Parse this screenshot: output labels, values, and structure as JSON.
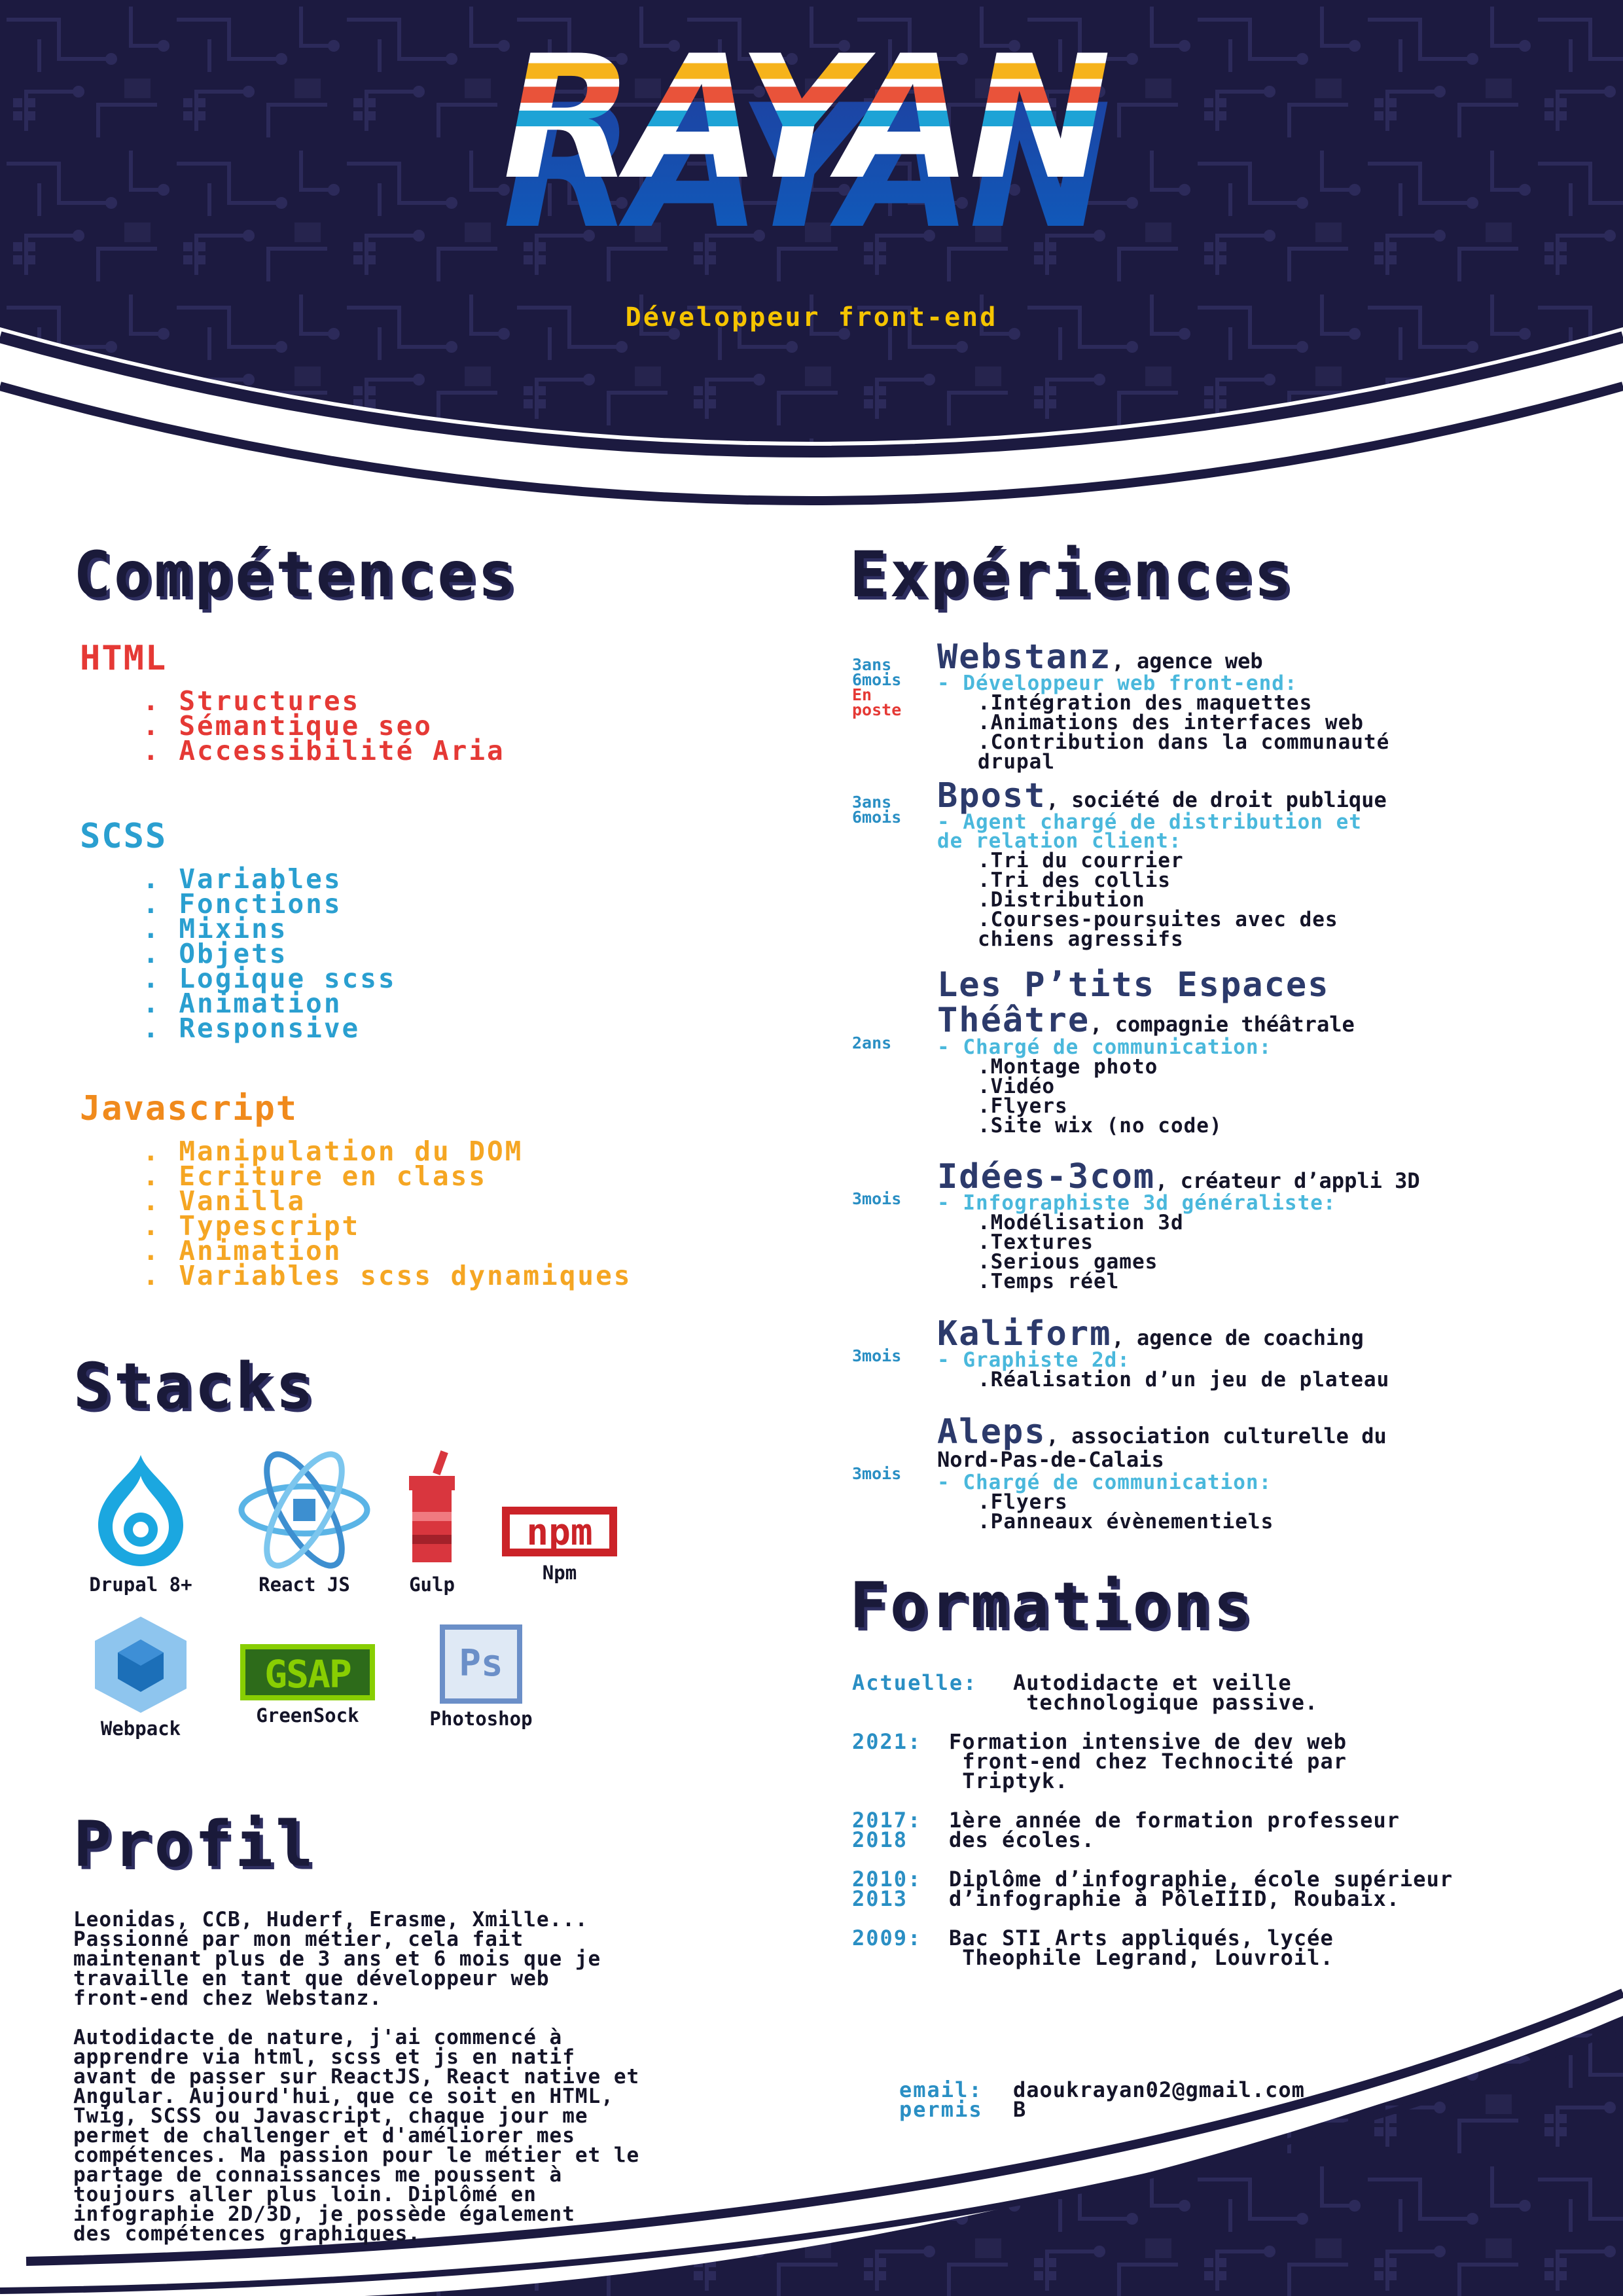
{
  "header": {
    "name": "RAYAN",
    "subtitle": "Développeur front-end"
  },
  "competences": {
    "title": "Compétences",
    "groups": [
      {
        "title": "HTML",
        "color": "#e53935",
        "items": [
          ". Structures",
          ". Sémantique seo",
          ". Accessibilité Aria"
        ]
      },
      {
        "title": "SCSS",
        "color": "#2a9fd0",
        "items": [
          ". Variables",
          ". Fonctions",
          ". Mixins",
          ". Objets",
          ". Logique scss",
          ". Animation",
          ". Responsive"
        ]
      },
      {
        "title": "Javascript",
        "color": "#f08a1c",
        "items": [
          ". Manipulation du DOM",
          ". Ecriture en class",
          ". Vanilla",
          ". Typescript",
          ". Animation",
          ". Variables scss dynamiques"
        ]
      }
    ]
  },
  "stacks": {
    "title": "Stacks",
    "items": [
      {
        "label": "Drupal 8+",
        "icon": "drupal-icon"
      },
      {
        "label": "React JS",
        "icon": "react-icon"
      },
      {
        "label": "Gulp",
        "icon": "gulp-icon"
      },
      {
        "label": "Npm",
        "icon": "npm-icon"
      },
      {
        "label": "Webpack",
        "icon": "webpack-icon"
      },
      {
        "label": "GreenSock",
        "icon": "gsap-icon"
      },
      {
        "label": "Photoshop",
        "icon": "photoshop-icon"
      }
    ],
    "logo_texts": {
      "npm": "npm",
      "gsap": "GSAP",
      "ps": "Ps"
    }
  },
  "profil": {
    "title": "Profil",
    "paragraphs": [
      "Leonidas, CCB, Huderf, Erasme, Xmille...\nPassionné par mon métier, cela fait\nmaintenant plus de 3 ans et 6 mois que je\ntravaille en tant que développeur web\nfront-end chez Webstanz.",
      "Autodidacte de nature, j'ai commencé à\napprendre via html, scss et js en natif\navant de passer sur ReactJS, React native et\nAngular. Aujourd'hui, que ce soit en HTML,\nTwig, SCSS ou Javascript, chaque jour me\npermet de challenger et d'améliorer mes\ncompétences. Ma passion pour le métier et le\npartage de connaissances me poussent à\ntoujours aller plus loin. Diplômé en\ninfographie 2D/3D, je possède également\ndes compétences graphiques."
    ]
  },
  "experiences": {
    "title": "Expériences",
    "items": [
      {
        "duration": "3ans\n6mois",
        "current": "En\nposte",
        "company": "Webstanz",
        "desc": ", agence web",
        "role": "- Développeur web front-end:",
        "tasks": [
          ".Intégration des maquettes",
          ".Animations des interfaces web",
          ".Contribution dans la communauté\ndrupal"
        ]
      },
      {
        "duration": "3ans\n6mois",
        "current": "",
        "company": "Bpost",
        "desc": ", société de droit publique",
        "role": "- Agent chargé de distribution et\nde relation client:",
        "tasks": [
          ".Tri du courrier",
          ".Tri des collis",
          ".Distribution",
          ".Courses-poursuites avec des\nchiens agressifs"
        ]
      },
      {
        "duration": "2ans",
        "current": "",
        "company": "Les P’tits Espaces\nThéâtre",
        "desc": ", compagnie théâtrale",
        "role": "- Chargé de communication:",
        "tasks": [
          ".Montage photo",
          ".Vidéo",
          ".Flyers",
          ".Site wix (no code)"
        ]
      },
      {
        "duration": "3mois",
        "current": "",
        "company": "Idées-3com",
        "desc": ", créateur d’appli 3D",
        "role": "- Infographiste 3d généraliste:",
        "tasks": [
          ".Modélisation 3d",
          ".Textures",
          ".Serious games",
          ".Temps réel"
        ]
      },
      {
        "duration": "3mois",
        "current": "",
        "company": "Kaliform",
        "desc": ", agence de coaching",
        "role": "- Graphiste 2d:",
        "tasks": [
          ".Réalisation d’un jeu de plateau"
        ]
      },
      {
        "duration": "3mois",
        "current": "",
        "company": "Aleps",
        "desc": ", association culturelle du\nNord-Pas-de-Calais",
        "role": "- Chargé de communication:",
        "tasks": [
          ".Flyers",
          ".Panneaux évènementiels"
        ]
      }
    ]
  },
  "formations": {
    "title": "Formations",
    "items": [
      {
        "year": "Actuelle:",
        "text": "Autodidacte et veille\n technologique passive."
      },
      {
        "year": "2021:",
        "text": "Formation intensive de dev web\n front-end chez Technocité par\n Triptyk."
      },
      {
        "year": "2017:\n2018",
        "text": "1ère année de formation professeur\ndes écoles."
      },
      {
        "year": "2010:\n2013",
        "text": "Diplôme d’infographie, école supérieur\nd’infographie à PôleIIID, Roubaix."
      },
      {
        "year": "2009:",
        "text": "Bac STI Arts appliqués, lycée\n Theophile Legrand, Louvroil."
      }
    ]
  },
  "contact": {
    "email_label": "email:",
    "email": "daoukrayan02@gmail.com",
    "permis_label": "permis",
    "permis": "B"
  },
  "colors": {
    "dark_navy": "#1c1a40",
    "html_red": "#e53935",
    "scss_blue": "#2a9fd0",
    "js_orange": "#f08a1c",
    "subtitle_yellow": "#f5c400",
    "role_blue": "#4ab8dc"
  }
}
